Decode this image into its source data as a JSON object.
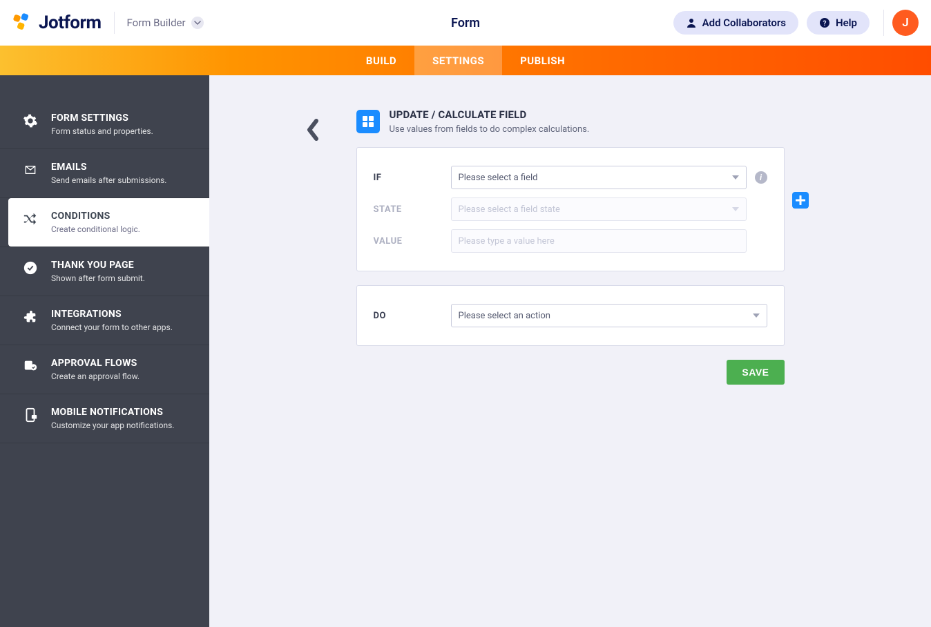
{
  "header": {
    "brand": "Jotform",
    "app_name": "Form Builder",
    "page_title": "Form",
    "collab_label": "Add Collaborators",
    "help_label": "Help",
    "avatar_letter": "J"
  },
  "tabs": {
    "build": "BUILD",
    "settings": "SETTINGS",
    "publish": "PUBLISH"
  },
  "sidebar": [
    {
      "title": "FORM SETTINGS",
      "sub": "Form status and properties."
    },
    {
      "title": "EMAILS",
      "sub": "Send emails after submissions."
    },
    {
      "title": "CONDITIONS",
      "sub": "Create conditional logic."
    },
    {
      "title": "THANK YOU PAGE",
      "sub": "Shown after form submit."
    },
    {
      "title": "INTEGRATIONS",
      "sub": "Connect your form to other apps."
    },
    {
      "title": "APPROVAL FLOWS",
      "sub": "Create an approval flow."
    },
    {
      "title": "MOBILE NOTIFICATIONS",
      "sub": "Customize your app notifications."
    }
  ],
  "condition": {
    "heading": "UPDATE / CALCULATE FIELD",
    "subheading": "Use values from fields to do complex calculations.",
    "labels": {
      "if": "IF",
      "state": "STATE",
      "value": "VALUE",
      "do": "DO"
    },
    "if_placeholder": "Please select a field",
    "state_placeholder": "Please select a field state",
    "value_placeholder": "Please type a value here",
    "do_placeholder": "Please select an action",
    "save_label": "SAVE"
  }
}
